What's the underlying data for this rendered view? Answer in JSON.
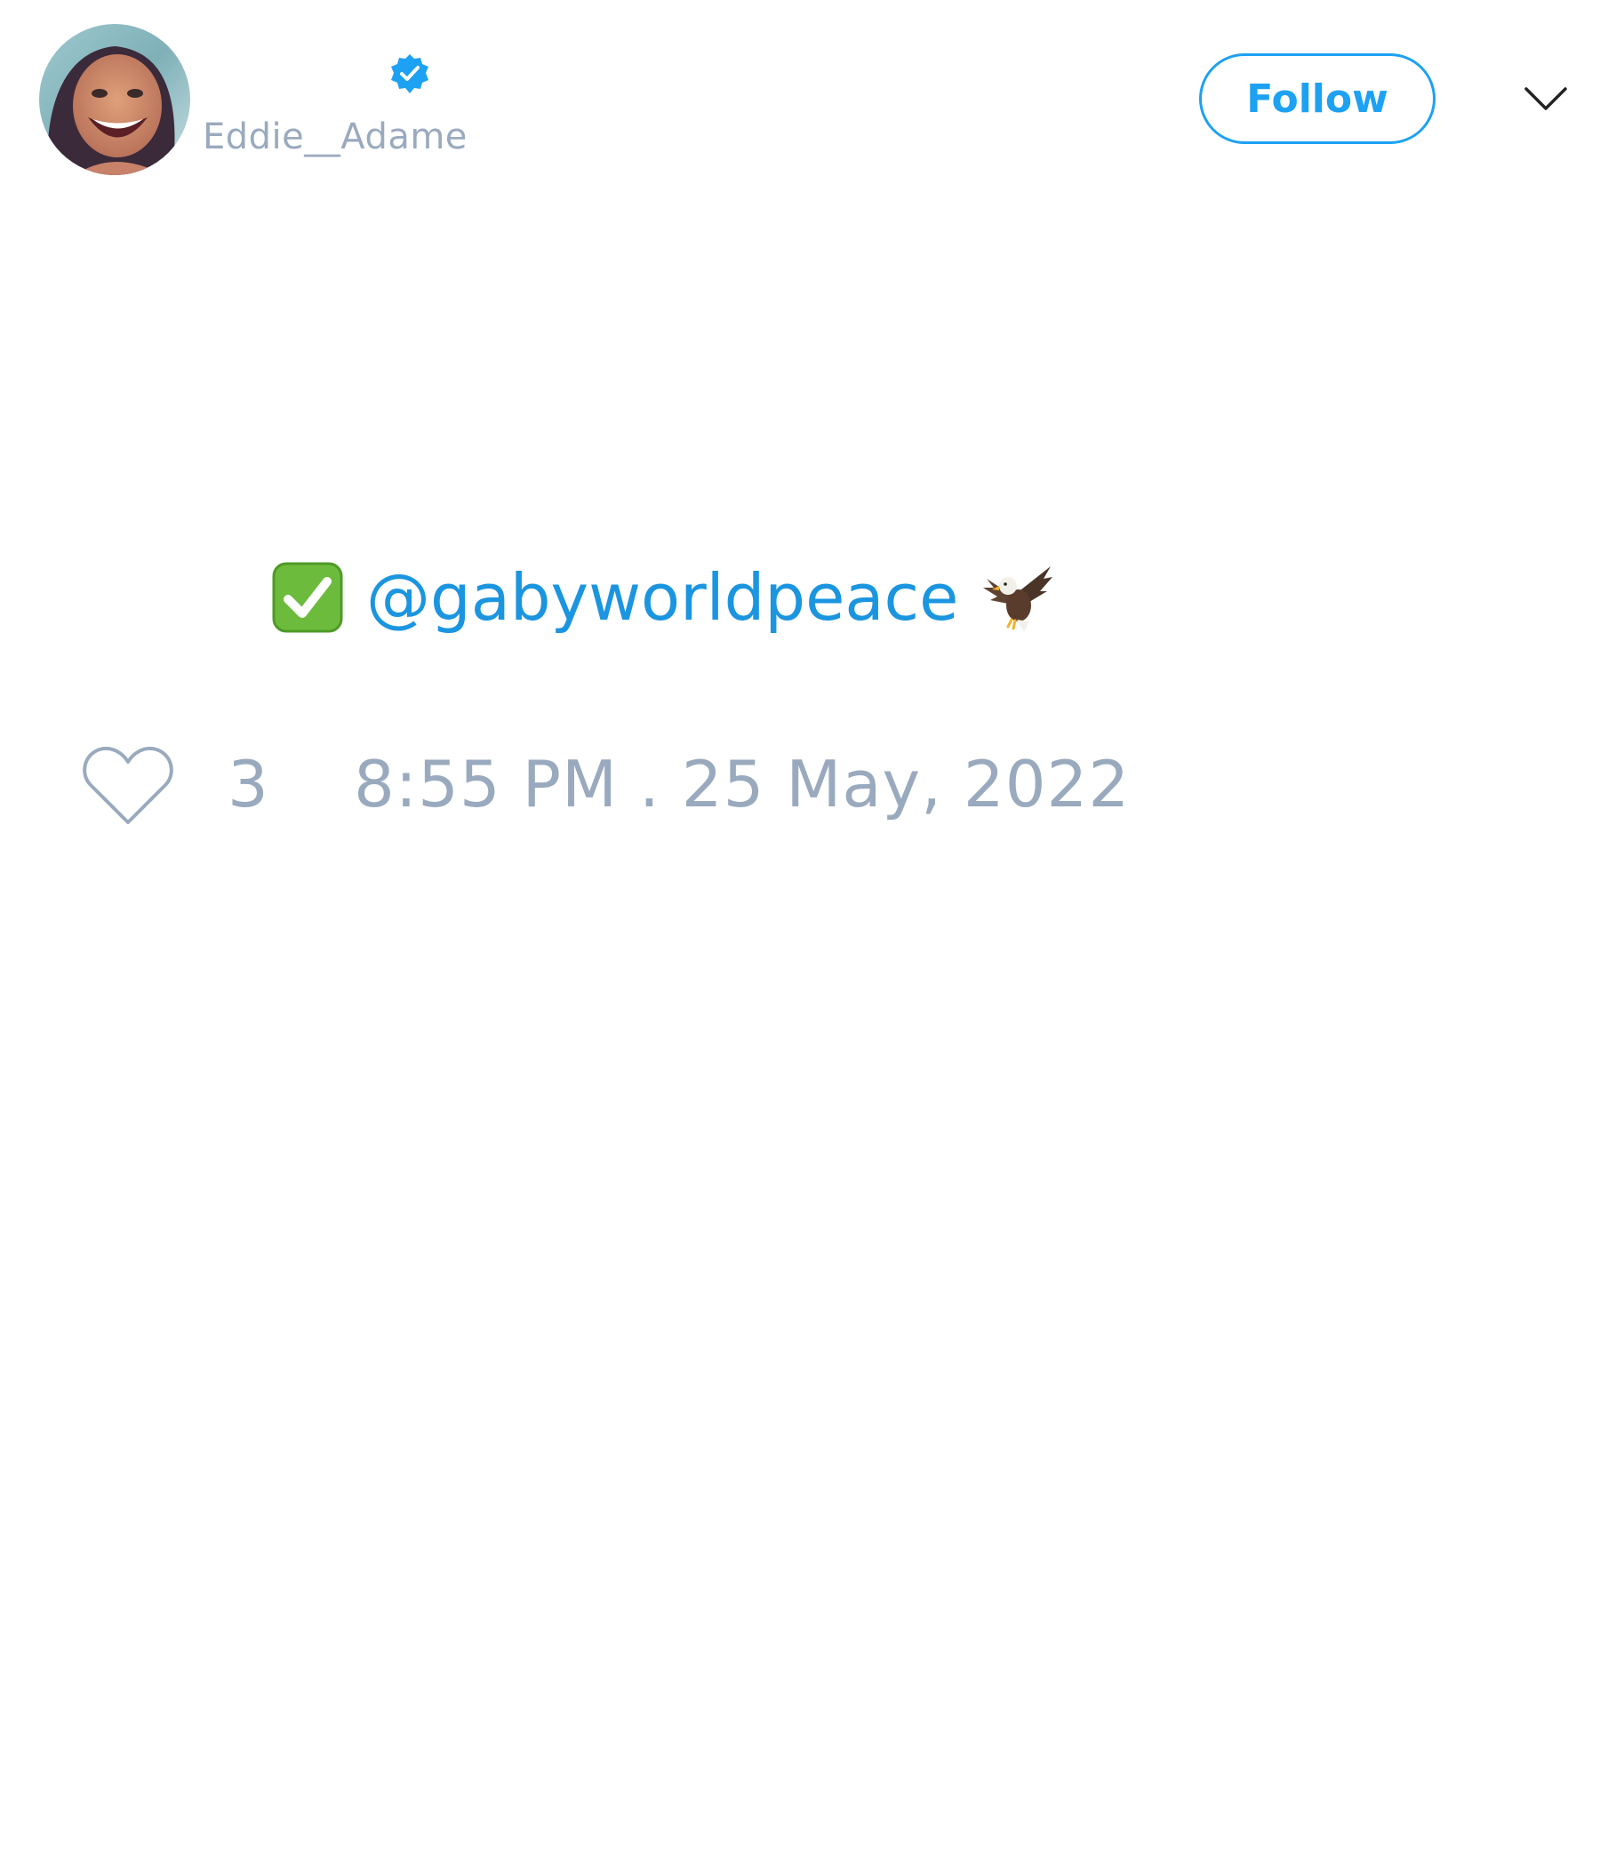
{
  "author": {
    "handle": "Eddie__Adame",
    "verified": true,
    "avatar_icon": "profile-photo"
  },
  "header": {
    "follow_label": "Follow",
    "menu_icon": "chevron-down-icon"
  },
  "tweet": {
    "check_emoji": "check-mark-button-emoji",
    "mention": "@gabyworldpeace",
    "eagle_emoji": "eagle-emoji"
  },
  "footer": {
    "like_icon": "heart-icon",
    "like_count": "3",
    "timestamp": "8:55 PM . 25 May, 2022"
  },
  "colors": {
    "accent": "#1da1f2",
    "mention": "#1b95e0",
    "muted": "#9aaabe",
    "background": "#ffffff"
  }
}
